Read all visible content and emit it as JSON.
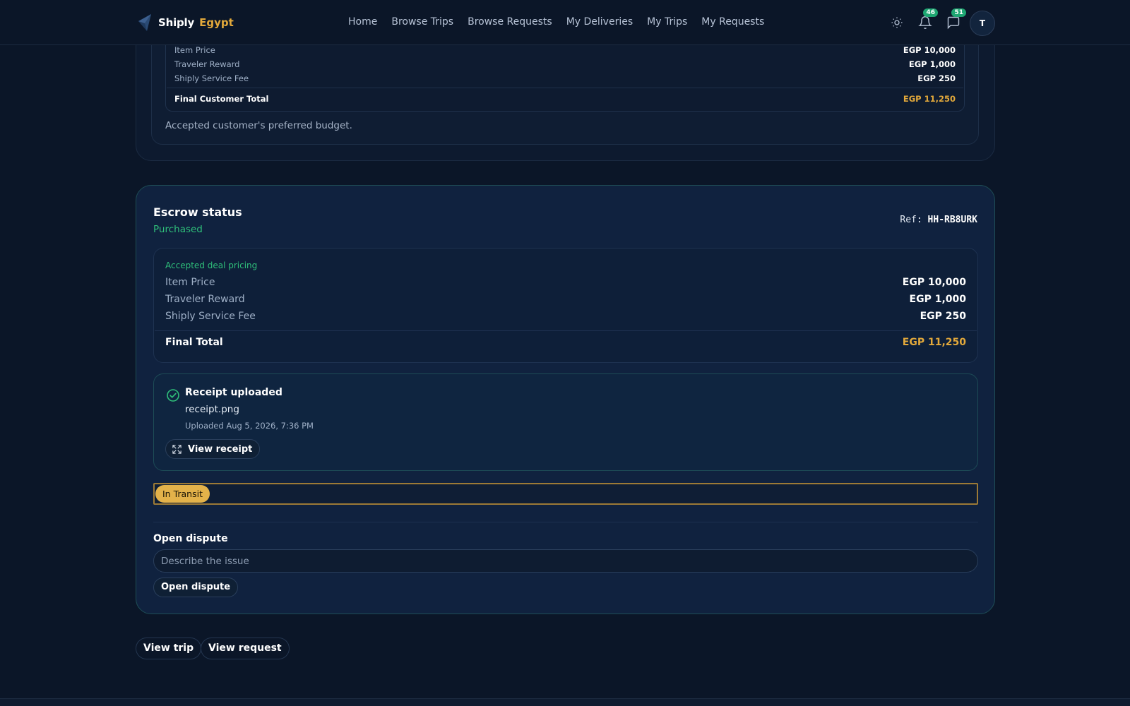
{
  "brand": {
    "name": "Shiply",
    "region": "Egypt"
  },
  "nav": {
    "items": [
      {
        "label": "Home"
      },
      {
        "label": "Browse Trips"
      },
      {
        "label": "Browse Requests"
      },
      {
        "label": "My Deliveries"
      },
      {
        "label": "My Trips"
      },
      {
        "label": "My Requests"
      }
    ]
  },
  "header": {
    "theme_icon": "sun-icon",
    "notifications_count": "46",
    "messages_count": "51",
    "avatar_initial": "T"
  },
  "customer_pricing": {
    "rows": [
      {
        "label": "Item Price",
        "value": "EGP 10,000"
      },
      {
        "label": "Traveler Reward",
        "value": "EGP 1,000"
      },
      {
        "label": "Shiply Service Fee",
        "value": "EGP 250"
      }
    ],
    "total": {
      "label": "Final Customer Total",
      "value": "EGP 11,250"
    },
    "note": "Accepted customer's preferred budget."
  },
  "escrow": {
    "title": "Escrow status",
    "status": "Purchased",
    "ref_label": "Ref:",
    "ref_code": "HH-RB8URK",
    "pricing": {
      "heading": "Accepted deal pricing",
      "rows": [
        {
          "label": "Item Price",
          "value": "EGP 10,000"
        },
        {
          "label": "Traveler Reward",
          "value": "EGP 1,000"
        },
        {
          "label": "Shiply Service Fee",
          "value": "EGP 250"
        }
      ],
      "total": {
        "label": "Final Total",
        "value": "EGP 11,250"
      }
    },
    "receipt": {
      "title": "Receipt uploaded",
      "filename": "receipt.png",
      "uploaded": "Uploaded Aug 5, 2026, 7:36 PM",
      "view_label": "View receipt"
    },
    "transit_label": "In Transit",
    "dispute": {
      "title": "Open dispute",
      "placeholder": "Describe the issue",
      "value": "",
      "button_label": "Open dispute"
    }
  },
  "actions": {
    "view_trip": "View trip",
    "view_request": "View request"
  },
  "colors": {
    "background": "#0b1628",
    "accent_gold": "#e3a93b",
    "accent_green": "#2fbf7a",
    "badge_green": "#1ea672"
  }
}
